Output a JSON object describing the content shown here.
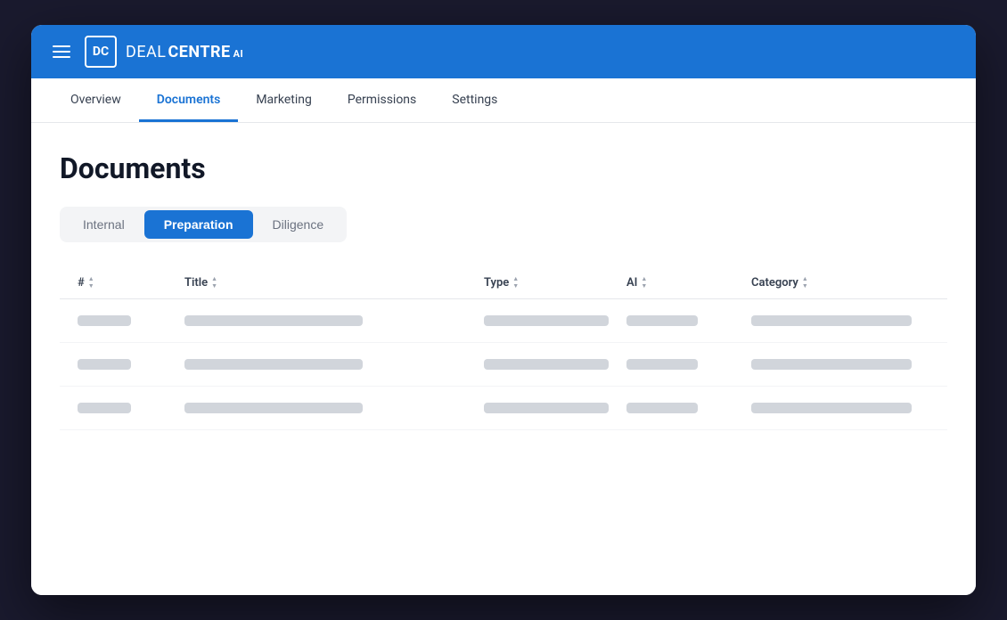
{
  "app": {
    "logo_box": "DC",
    "logo_deal": "DEAL",
    "logo_centre": "CENTRE",
    "logo_ai": "AI"
  },
  "nav": {
    "tabs": [
      {
        "id": "overview",
        "label": "Overview",
        "active": false
      },
      {
        "id": "documents",
        "label": "Documents",
        "active": true
      },
      {
        "id": "marketing",
        "label": "Marketing",
        "active": false
      },
      {
        "id": "permissions",
        "label": "Permissions",
        "active": false
      },
      {
        "id": "settings",
        "label": "Settings",
        "active": false
      }
    ]
  },
  "page": {
    "title": "Documents"
  },
  "filter_tabs": [
    {
      "id": "internal",
      "label": "Internal",
      "active": false
    },
    {
      "id": "preparation",
      "label": "Preparation",
      "active": true
    },
    {
      "id": "diligence",
      "label": "Diligence",
      "active": false
    }
  ],
  "table": {
    "columns": [
      {
        "id": "number",
        "label": "#"
      },
      {
        "id": "title",
        "label": "Title"
      },
      {
        "id": "type",
        "label": "Type"
      },
      {
        "id": "ai",
        "label": "AI"
      },
      {
        "id": "category",
        "label": "Category"
      }
    ],
    "rows": [
      {
        "id": 1
      },
      {
        "id": 2
      },
      {
        "id": 3
      }
    ]
  }
}
